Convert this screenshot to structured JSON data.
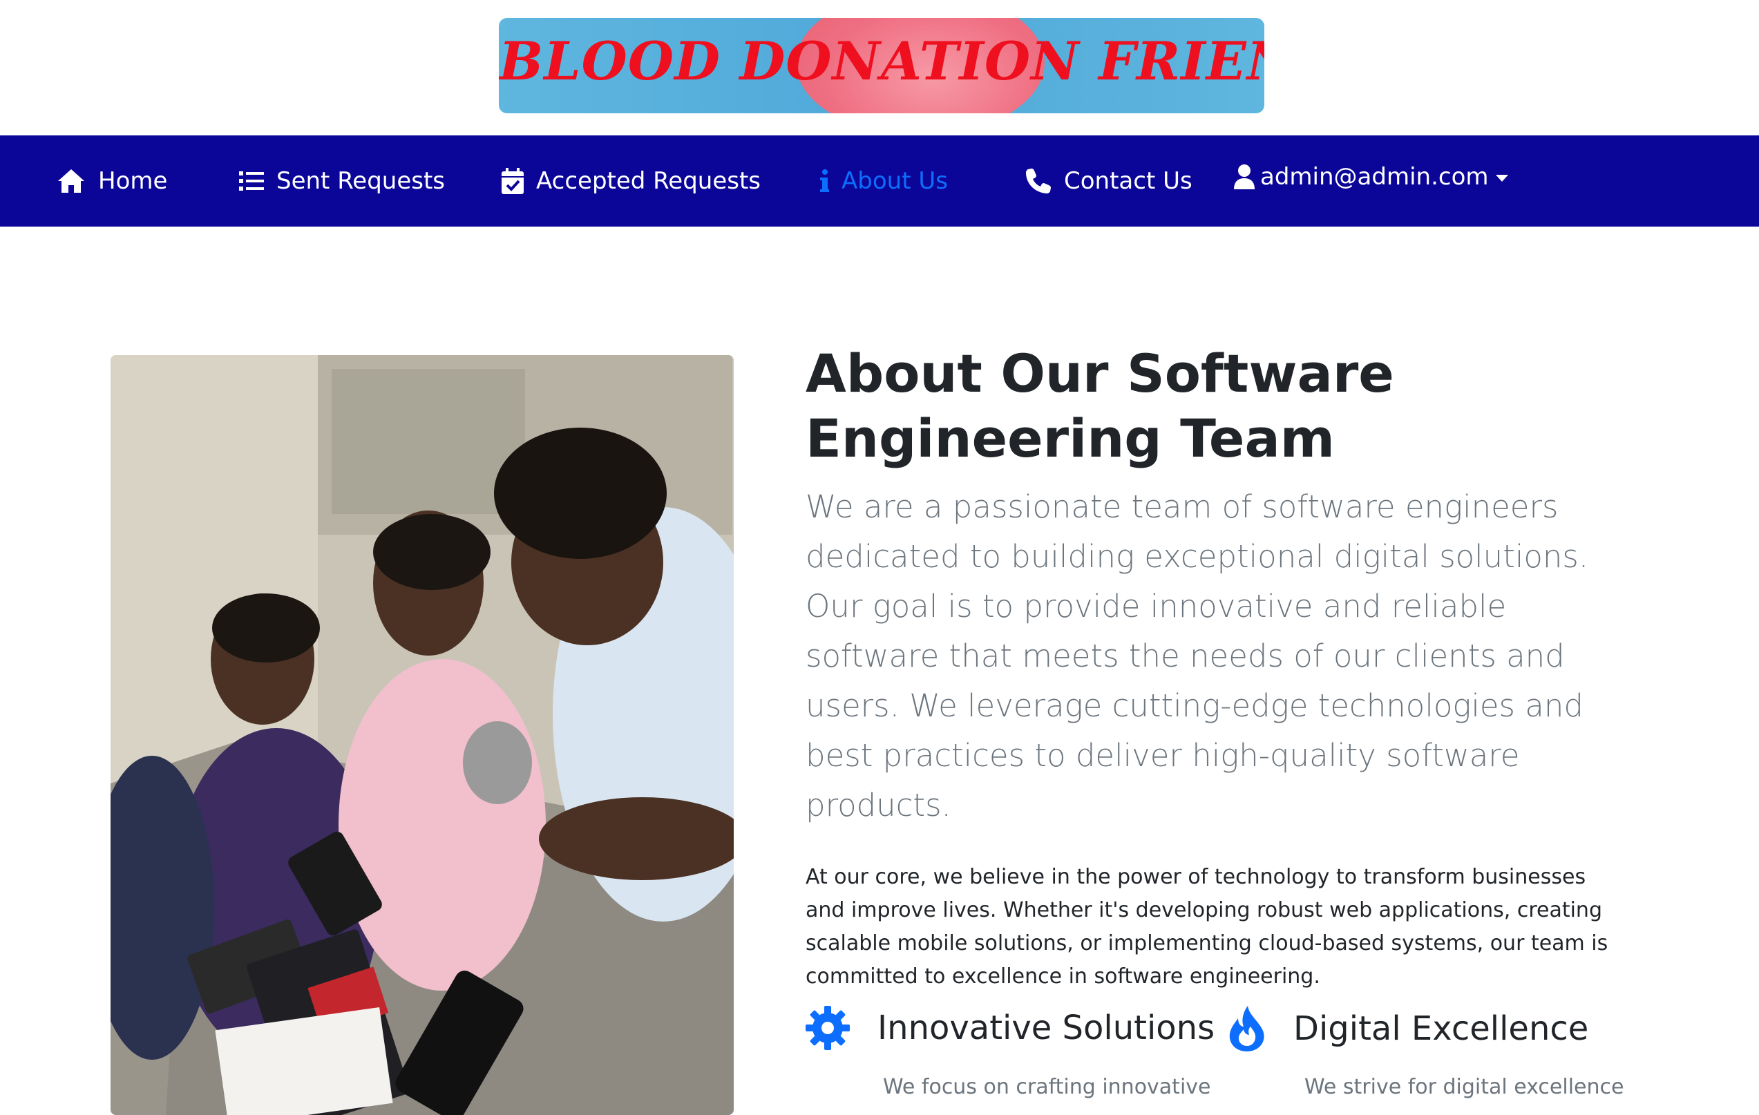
{
  "logo": {
    "text": "BLOOD DONATION FRIEND"
  },
  "nav": {
    "items": [
      {
        "label": "Home",
        "icon": "home-icon"
      },
      {
        "label": "Sent Requests",
        "icon": "list-icon"
      },
      {
        "label": "Accepted Requests",
        "icon": "calendar-check-icon"
      },
      {
        "label": "About Us",
        "icon": "info-icon",
        "active": true
      },
      {
        "label": "Contact Us",
        "icon": "phone-icon"
      }
    ],
    "user": {
      "label": "admin@admin.com",
      "icon": "user-icon"
    }
  },
  "about": {
    "title": "About Our Software Engineering Team",
    "lead": "We are a passionate team of software engineers dedicated to building exceptional digital solutions. Our goal is to provide innovative and reliable software that meets the needs of our clients and users. We leverage cutting-edge technologies and best practices to deliver high-quality software products.",
    "body": "At our core, we believe in the power of technology to transform businesses and improve lives. Whether it's developing robust web applications, creating scalable mobile solutions, or implementing cloud-based systems, our team is committed to excellence in software engineering."
  },
  "features": [
    {
      "title": "Innovative Solutions",
      "icon": "gear-icon",
      "desc": "We focus on crafting innovative"
    },
    {
      "title": "Digital Excellence",
      "icon": "fire-icon",
      "desc": "We strive for digital excellence"
    }
  ],
  "colors": {
    "navbar": "#0b0698",
    "active_link": "#0d6efd",
    "logo_text": "#ee0f1f",
    "icon_blue": "#0d6efd"
  }
}
